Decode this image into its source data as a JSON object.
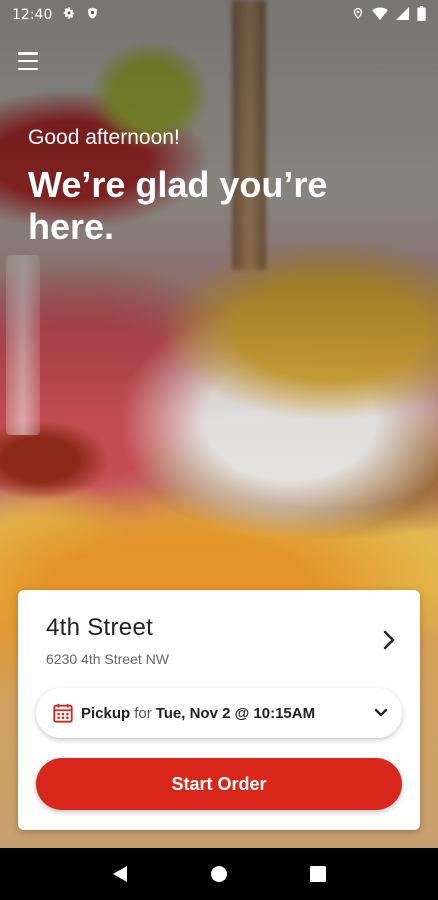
{
  "status_bar": {
    "time": "12:40",
    "left_icons": [
      "settings-icon",
      "shield-icon"
    ],
    "right_icons": [
      "location-icon",
      "wifi-icon",
      "signal-icon",
      "battery-icon"
    ]
  },
  "header": {
    "greeting": "Good afternoon!",
    "headline": "We’re glad you’re here."
  },
  "store": {
    "name": "4th Street",
    "address": "6230 4th Street NW"
  },
  "pickup": {
    "mode": "Pickup",
    "connector": "for",
    "time": "Tue, Nov 2 @ 10:15AM"
  },
  "actions": {
    "start_order": "Start Order"
  },
  "colors": {
    "accent": "#d8271a",
    "card": "#ffffff"
  },
  "nav": [
    "back-icon",
    "home-icon",
    "recents-icon"
  ]
}
